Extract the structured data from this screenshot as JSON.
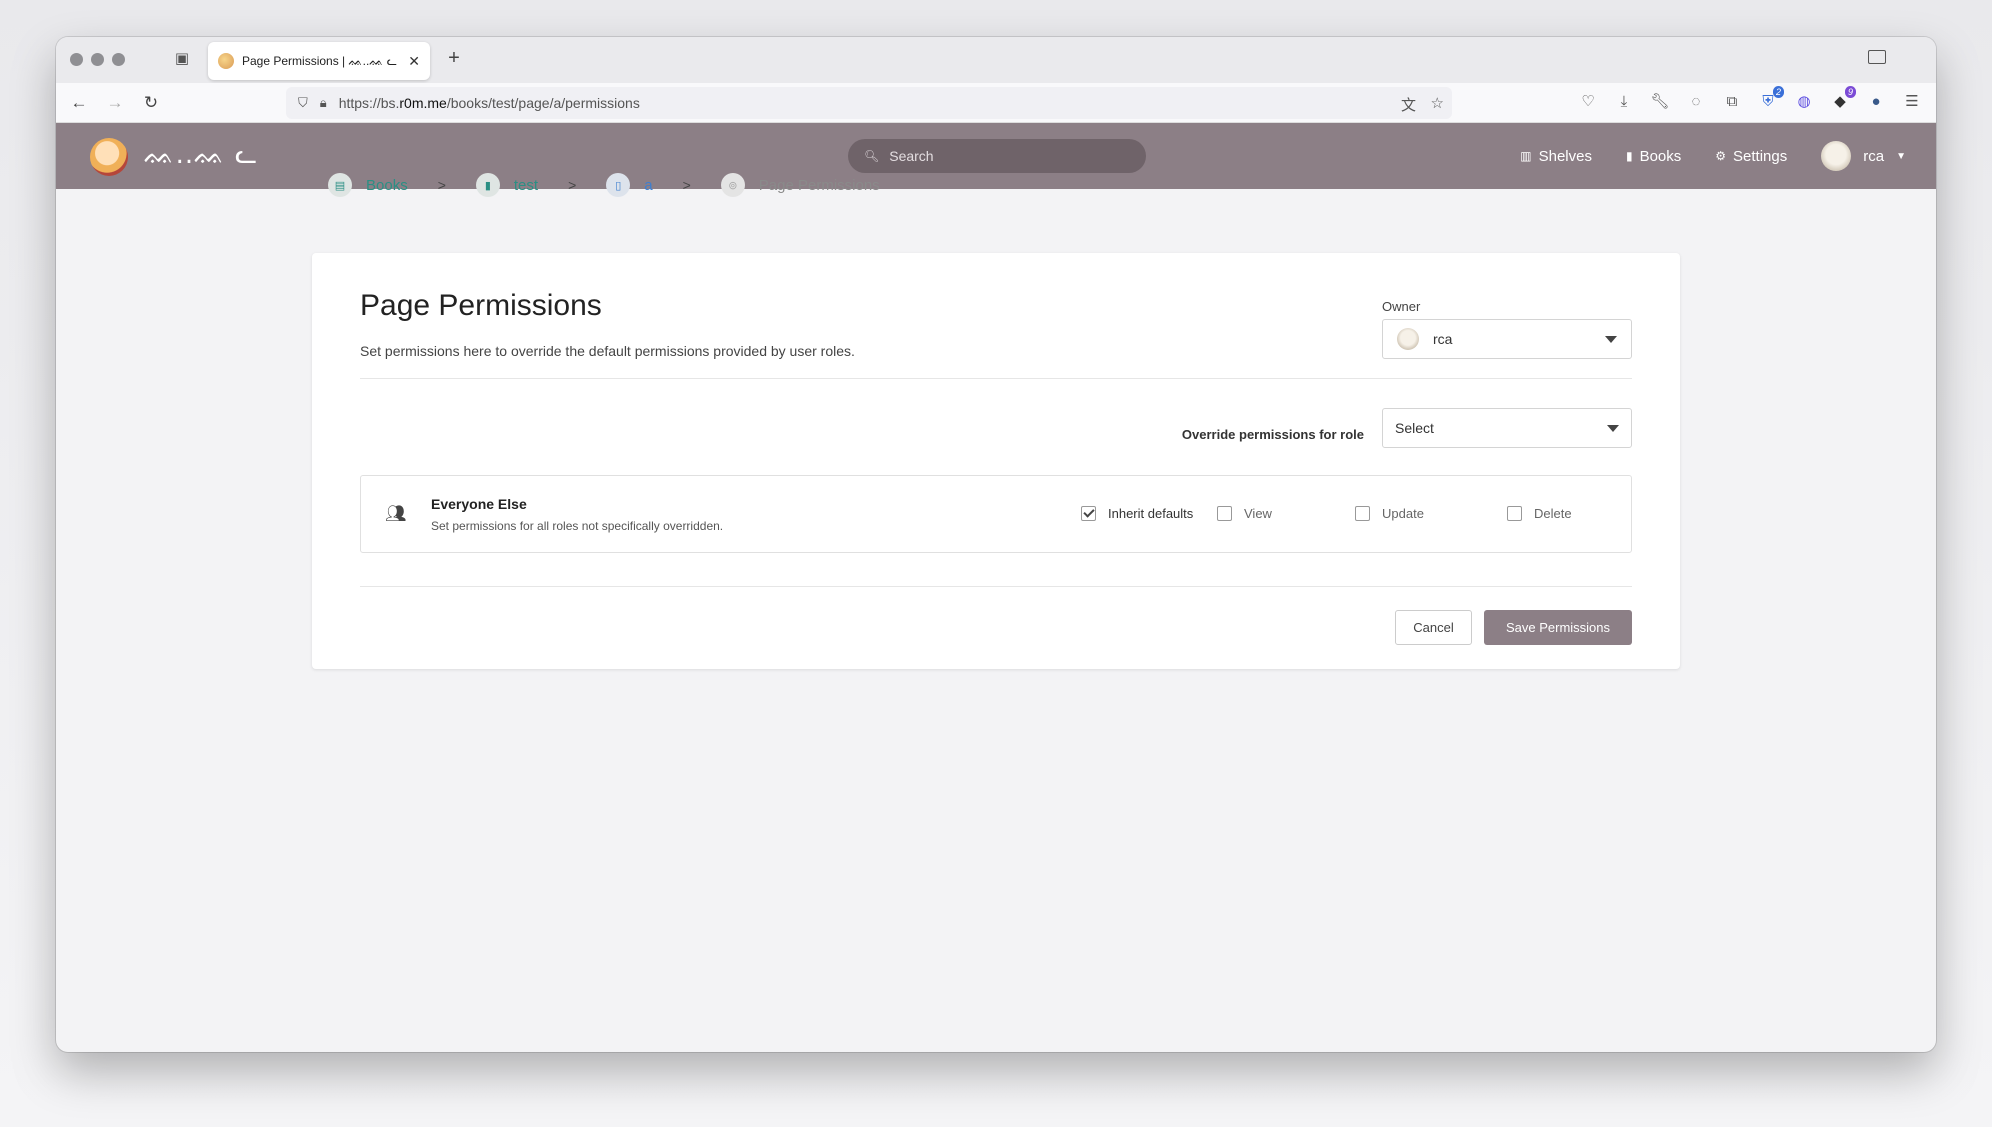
{
  "browser": {
    "tab_title": "Page Permissions | ᨐ..ᨐ ᓚ",
    "url_prefix": "https://bs.",
    "url_host": "r0m.me",
    "url_path": "/books/test/page/a/permissions",
    "extension_badges": {
      "first": "2",
      "second": "9"
    }
  },
  "header": {
    "site_name": "ᨐ..ᨐ ᓚ",
    "search_placeholder": "Search",
    "nav": [
      {
        "label": "Shelves",
        "icon": "shelves-icon"
      },
      {
        "label": "Books",
        "icon": "book-icon"
      },
      {
        "label": "Settings",
        "icon": "gear-icon"
      }
    ],
    "user": "rca"
  },
  "breadcrumb": [
    {
      "label": "Books",
      "icon": "books-icon"
    },
    {
      "label": "test",
      "icon": "book-icon"
    },
    {
      "label": "a",
      "icon": "page-icon"
    },
    {
      "label": "Page Permissions",
      "icon": "lock-icon"
    }
  ],
  "main": {
    "title": "Page Permissions",
    "description": "Set permissions here to override the default permissions provided by user roles.",
    "owner_label": "Owner",
    "owner_value": "rca",
    "override_label": "Override permissions for role",
    "role_select_value": "Select",
    "everyone": {
      "name": "Everyone Else",
      "description": "Set permissions for all roles not specifically overridden.",
      "inherit_label": "Inherit defaults",
      "inherit_checked": true,
      "view_label": "View",
      "update_label": "Update",
      "delete_label": "Delete"
    },
    "cancel_label": "Cancel",
    "save_label": "Save Permissions"
  },
  "colors": {
    "header_bg": "#8c7f86",
    "link_teal": "#2b8f84",
    "page_blue": "#3f7fcf"
  }
}
